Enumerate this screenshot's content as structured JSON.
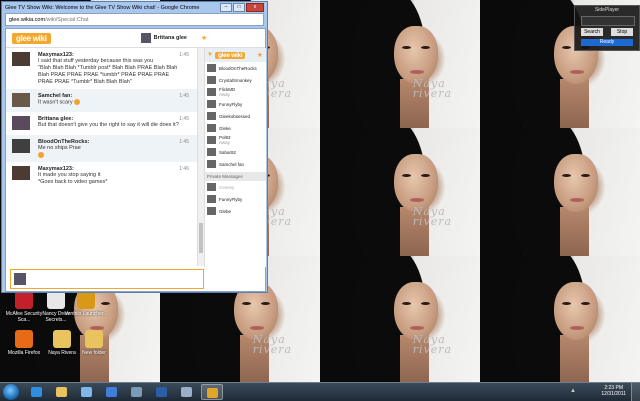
{
  "window": {
    "title": "Glee TV Show Wiki: Welcome to the Glee TV Show Wiki chat! - Google Chrome",
    "url_host": "glee.wikia.com",
    "url_path": "/wiki/Special:Chat",
    "minimize_glyph": "–",
    "maximize_glyph": "□",
    "close_glyph": "x"
  },
  "chat": {
    "logo": "glee wiki",
    "current_user": "Brittana glee",
    "messages": [
      {
        "user": "Maxymax123:",
        "time": "1:45",
        "lines": [
          "I said that stuff yesterday because this was you",
          "\"Blah Blah Blah *Tumblr post* Blah Blah PRAE Blah Blah",
          "Blah PRAE PRAE PRAE *tumblr* PRAE PRAE PRAE",
          "PRAE PRAE *Tumblr* Blah Blah Blah\""
        ]
      },
      {
        "user": "Samchel fan:",
        "time": "1:45",
        "lines": [
          "It wasn't scary"
        ]
      },
      {
        "user": "Brittana glee:",
        "time": "1:45",
        "lines": [
          "But that doesn't give you the right to say it will die does it?"
        ]
      },
      {
        "user": "BloodOnTheRocks:",
        "time": "1:45",
        "lines": [
          "Me no ships Prae",
          ""
        ]
      },
      {
        "user": "Maxymax123:",
        "time": "1:46",
        "lines": [
          "It made you stop saying it",
          "*Goes back to video games*"
        ]
      }
    ],
    "input_value": ""
  },
  "userlist": {
    "room_logo": "glee wiki",
    "users": [
      {
        "name": "BloodOnTheRocks",
        "status": ""
      },
      {
        "name": "CrystalSmonkey",
        "status": ""
      },
      {
        "name": "FlickMD",
        "status": "Away"
      },
      {
        "name": "FunnyFlyby",
        "status": ""
      },
      {
        "name": "Gleekobsessed",
        "status": ""
      },
      {
        "name": "Gleke",
        "status": ""
      },
      {
        "name": "Pol93",
        "status": "Away"
      },
      {
        "name": "Sahar92",
        "status": ""
      },
      {
        "name": "Samchel fan",
        "status": ""
      }
    ],
    "private_header": "Private Messages",
    "private_users": [
      {
        "name": "Cenexy",
        "dim": true
      },
      {
        "name": "FunnyFlyby",
        "dim": false
      },
      {
        "name": "Glebe",
        "dim": false
      }
    ]
  },
  "sideplayer": {
    "title": "SidePlayer",
    "search_label": "Search",
    "stop_label": "Stop",
    "status": "Ready"
  },
  "desktop_icons": [
    {
      "label": "McAfee Security Sca...",
      "color": "#c3202a"
    },
    {
      "label": "Nancy Drew Secrets...",
      "color": "#e7e7e7"
    },
    {
      "label": "Ventrilo Launcher...",
      "color": "#d89a16"
    },
    {
      "label": "Mozilla Firefox",
      "color": "#e66a18"
    },
    {
      "label": "Naya Rivera",
      "color": "#e9c35e"
    },
    {
      "label": "New folder",
      "color": "#e9c35e"
    }
  ],
  "wallpaper_caption": [
    "Naya",
    "rivera"
  ],
  "taskbar": {
    "time": "2:23 PM",
    "date": "12/31/2011",
    "items": [
      {
        "name": "internet-explorer-icon",
        "color": "#2f8ee0",
        "active": false
      },
      {
        "name": "explorer-icon",
        "color": "#e9c35e",
        "active": false
      },
      {
        "name": "itunes-icon",
        "color": "#7fb7ea",
        "active": false
      },
      {
        "name": "media-player-icon",
        "color": "#3d7fd9",
        "active": false
      },
      {
        "name": "mail-icon",
        "color": "#7a9ab8",
        "active": false
      },
      {
        "name": "word-icon",
        "color": "#2c5ea8",
        "active": false
      },
      {
        "name": "folder-icon",
        "color": "#9bb0c6",
        "active": false
      },
      {
        "name": "chrome-icon",
        "color": "#e0a52a",
        "active": true
      }
    ]
  }
}
